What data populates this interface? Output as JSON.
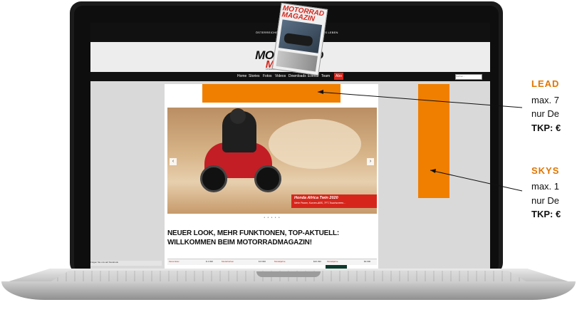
{
  "site": {
    "topbar_left": "ÖSTERREICHS PLATTFORM",
    "topbar_right": "FÜR SCHRÄGES LEBEN",
    "badge": "1",
    "logo_top": "MOTORRAD",
    "logo_bottom": "MAGAZIN",
    "logo_tag": "ÖSTERREICHS LEITMEDIUM FÜR MOTORRAD LEBEN",
    "nav": [
      "Home",
      "Stories",
      "Fotos",
      "Videos",
      "Downloads",
      "Events",
      "Team"
    ],
    "nav_abo": "Abo",
    "search_placeholder": "Suchen...",
    "magazine_title": "MOTORRAD MAGAZIN",
    "slider_caption_title": "Honda Africa Twin 2020",
    "slider_caption_sub": "Mehr Power, Kurven-ABS, TFT-Touchscreen...",
    "headline_line1": "NEUER LOOK, MEHR FUNKTIONEN, TOP-AKTUELL:",
    "headline_line2": "WILLKOMMEN BEIM MOTORRADMAGAZIN!",
    "ad_row": [
      "Motorräder",
      "$ 4.990",
      "Modellreihen",
      "$ 8.990",
      "Modelljahre",
      "$16.390",
      "Modelljahre",
      "$3.990"
    ],
    "fb_text": "Folgen Sie uns auf Facebook"
  },
  "annotations": {
    "leaderboard": {
      "title": "LEAD",
      "line1": "max. 7",
      "line2": "nur De",
      "tkp": "TKP: €"
    },
    "skyscraper": {
      "title": "SKYS",
      "line1": "max. 1",
      "line2": "nur De",
      "tkp": "TKP: €"
    }
  },
  "colors": {
    "accent": "#f07f00",
    "brand_red": "#d6261c"
  }
}
